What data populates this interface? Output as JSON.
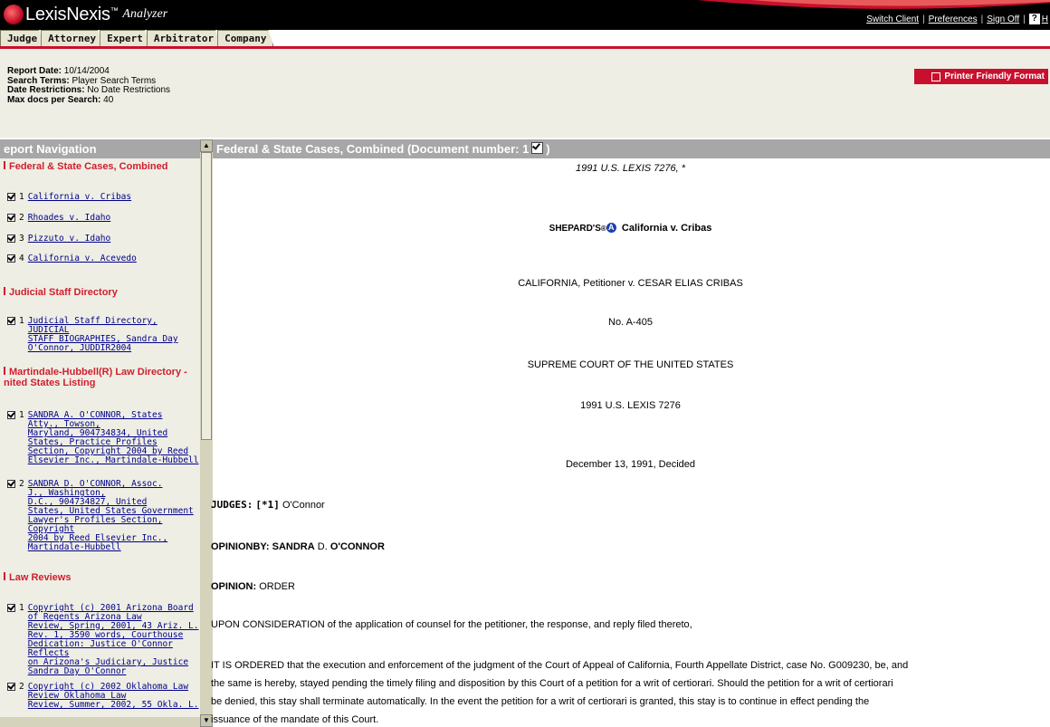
{
  "app": {
    "brand": "LexisNexis",
    "brand_sup": "™",
    "product": "Analyzer"
  },
  "toplinks": {
    "switch_client": "Switch Client",
    "preferences": "Preferences",
    "sign_off": "Sign Off",
    "help": "?",
    "help_text": "H"
  },
  "tabs": [
    "Judge",
    "Attorney",
    "Expert",
    "Arbitrator",
    "Company"
  ],
  "report": {
    "date_label": "Report Date:",
    "date_value": "10/14/2004",
    "terms_label": "Search Terms:",
    "terms_value": "Player Search Terms",
    "restrict_label": "Date Restrictions:",
    "restrict_value": "No Date Restrictions",
    "max_label": "Max docs per Search:",
    "max_value": "40"
  },
  "print_button": "Printer Friendly Format",
  "nav": {
    "title": "eport Navigation",
    "sections": [
      {
        "title": "Federal & State Cases, Combined",
        "items": [
          {
            "n": "1",
            "text": "California v. Cribas"
          },
          {
            "n": "2",
            "text": "Rhoades v. Idaho"
          },
          {
            "n": "3",
            "text": "Pizzuto v. Idaho"
          },
          {
            "n": "4",
            "text": "California v. Acevedo"
          }
        ]
      },
      {
        "title": "Judicial Staff Directory",
        "items": [
          {
            "n": "1",
            "lines": [
              "Judicial Staff Directory, JUDICIAL",
              "STAFF BIOGRAPHIES, Sandra Day",
              "O'Connor, JUDDIR2004"
            ]
          }
        ]
      },
      {
        "title_lines": [
          "Martindale-Hubbell(R) Law Directory -",
          "nited States Listing"
        ],
        "items": [
          {
            "n": "1",
            "lines": [
              "SANDRA A. O'CONNOR, States",
              "Atty., Towson,",
              "Maryland, 904734834, United",
              "States, Practice Profiles",
              "Section, Copyright 2004 by Reed",
              "Elsevier Inc., Martindale-Hubbell"
            ]
          },
          {
            "n": "2",
            "lines": [
              "SANDRA D. O'CONNOR, Assoc.",
              "J., Washington,",
              "D.C., 904734827, United",
              "States, United States Government",
              "Lawyer's Profiles Section, Copyright",
              "2004 by Reed Elsevier Inc.,",
              "Martindale-Hubbell"
            ]
          }
        ]
      },
      {
        "title": "Law Reviews",
        "items": [
          {
            "n": "1",
            "lines": [
              "Copyright (c) 2001 Arizona Board",
              "of Regents Arizona Law",
              "Review, Spring, 2001, 43 Ariz. L.",
              "Rev. 1, 3590 words, Courthouse",
              "Dedication: Justice O'Connor Reflects",
              "on Arizona's Judiciary, Justice",
              "Sandra Day O'Connor"
            ]
          },
          {
            "n": "2",
            "lines": [
              "Copyright (c) 2002 Oklahoma Law",
              "Review Oklahoma Law",
              "Review, Summer, 2002, 55 Okla. L."
            ]
          }
        ]
      }
    ]
  },
  "document": {
    "header": "Federal & State Cases, Combined (Document number: 1",
    "header_close": ")",
    "cite_top": "1991 U.S. LEXIS 7276, *",
    "shepards": "SHEPARD'S",
    "shepards_mark": "®",
    "shepards_icon": "A",
    "case_name": "California v. Cribas",
    "parties": "CALIFORNIA, Petitioner v. CESAR ELIAS CRIBAS",
    "docket": "No. A-405",
    "court": "SUPREME COURT OF THE UNITED STATES",
    "cite": "1991 U.S. LEXIS 7276",
    "decided": "December 13, 1991, Decided",
    "judges_label": "JUDGES:",
    "judges_star": "[*1]",
    "judges_value": "O'Connor",
    "opinionby_label": "OPINIONBY:",
    "opinionby_value_bold": "SANDRA",
    "opinionby_value_rest": "D.",
    "opinionby_value_last": "O'CONNOR",
    "opinion_label": "OPINION:",
    "opinion_value": "ORDER",
    "para1": "UPON CONSIDERATION of the application of counsel for the petitioner, the response, and reply filed thereto,",
    "para2_lines": [
      "IT IS ORDERED that the execution and enforcement of the judgment of the Court of Appeal of California, Fourth Appellate District, case No. G009230, be, and",
      "the same is hereby, stayed pending the timely filing and disposition by this Court of a petition for a writ of certiorari. Should the petition for a writ of certiorari",
      "be denied, this stay shall terminate automatically. In the event the petition for a writ of certiorari is granted, this stay is to continue in effect pending the",
      "issuance of the mandate of this Court."
    ]
  },
  "colors": {
    "accent_red": "#c8102e",
    "panel_beige": "#eeeee4",
    "header_gray": "#a7a7a7",
    "link_blue": "#00008b"
  }
}
